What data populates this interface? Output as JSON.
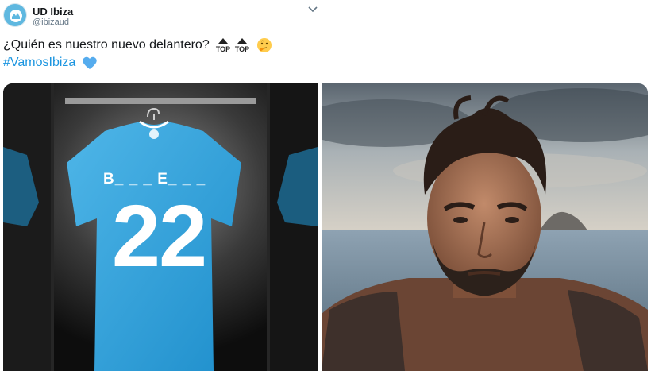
{
  "account": {
    "name": "UD Ibiza",
    "handle": "@ibizaud",
    "avatar_icon": "ud-ibiza-crest-icon"
  },
  "menu": {
    "icon": "chevron-down-icon"
  },
  "tweet": {
    "text": "¿Quién es nuestro nuevo delantero?",
    "emojis": [
      "top-arrow-emoji",
      "top-arrow-emoji",
      "thinking-face-emoji"
    ],
    "emoji_label": "TOP",
    "hashtag": "#VamosIbiza",
    "trailing_emoji": "blue-heart-emoji"
  },
  "media": [
    {
      "kind": "jersey-image",
      "jersey_name": "B_ _ _ E_ _ _",
      "jersey_number": "22",
      "jersey_color": "#2ea2dc"
    },
    {
      "kind": "selfie-photo"
    }
  ],
  "colors": {
    "link": "#1b95e0",
    "secondary_text": "#657786",
    "heart": "#55acee"
  }
}
